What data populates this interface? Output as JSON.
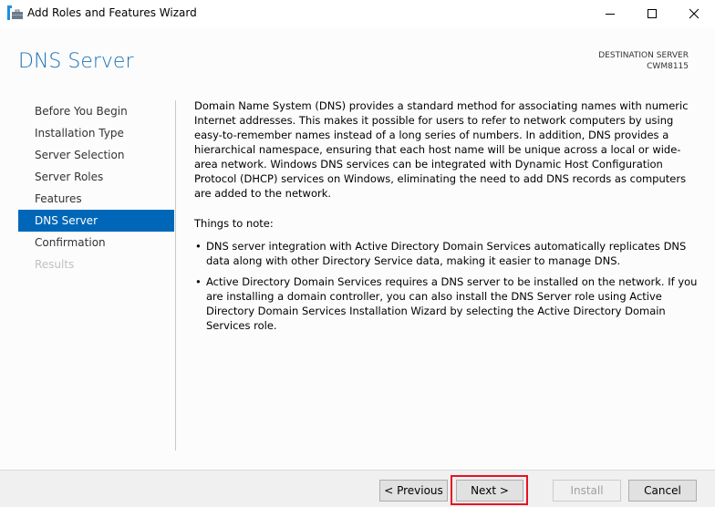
{
  "window": {
    "title": "Add Roles and Features Wizard",
    "controls": [
      "minimize",
      "maximize",
      "close"
    ]
  },
  "header": {
    "page_title": "DNS Server",
    "destination_label": "DESTINATION SERVER",
    "destination_server": "CWM8115"
  },
  "nav": {
    "items": [
      {
        "label": "Before You Begin",
        "state": "normal"
      },
      {
        "label": "Installation Type",
        "state": "normal"
      },
      {
        "label": "Server Selection",
        "state": "normal"
      },
      {
        "label": "Server Roles",
        "state": "normal"
      },
      {
        "label": "Features",
        "state": "normal"
      },
      {
        "label": "DNS Server",
        "state": "active"
      },
      {
        "label": "Confirmation",
        "state": "normal"
      },
      {
        "label": "Results",
        "state": "disabled"
      }
    ]
  },
  "main": {
    "description": "Domain Name System (DNS) provides a standard method for associating names with numeric Internet addresses. This makes it possible for users to refer to network computers by using easy-to-remember names instead of a long series of numbers. In addition, DNS provides a hierarchical namespace, ensuring that each host name will be unique across a local or wide-area network. Windows DNS services can be integrated with Dynamic Host Configuration Protocol (DHCP) services on Windows, eliminating the need to add DNS records as computers are added to the network.",
    "notes_heading": "Things to note:",
    "notes": [
      "DNS server integration with Active Directory Domain Services automatically replicates DNS data along with other Directory Service data, making it easier to manage DNS.",
      "Active Directory Domain Services requires a DNS server to be installed on the network. If you are installing a domain controller, you can also install the DNS Server role using Active Directory Domain Services Installation Wizard by selecting the Active Directory Domain Services role."
    ]
  },
  "footer": {
    "previous_label": "< Previous",
    "next_label": "Next >",
    "install_label": "Install",
    "cancel_label": "Cancel"
  },
  "colors": {
    "accent": "#0067b8",
    "title": "#1e73b8",
    "highlight": "#e81123"
  }
}
